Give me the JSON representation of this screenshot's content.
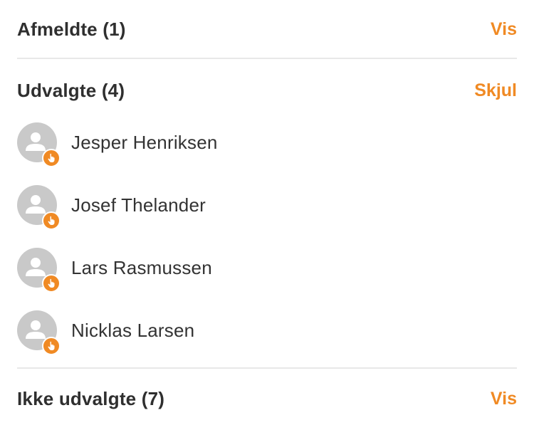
{
  "sections": [
    {
      "title": "Afmeldte (1)",
      "action": "Vis"
    },
    {
      "title": "Udvalgte (4)",
      "action": "Skjul"
    },
    {
      "title": "Ikke udvalgte (7)",
      "action": "Vis"
    }
  ],
  "selected_people": [
    {
      "name": "Jesper Henriksen",
      "avatar_icon": "user-placeholder-icon",
      "badge_icon": "hand-pointer-icon"
    },
    {
      "name": "Josef Thelander",
      "avatar_icon": "user-placeholder-icon",
      "badge_icon": "hand-pointer-icon"
    },
    {
      "name": "Lars Rasmussen",
      "avatar_icon": "user-placeholder-icon",
      "badge_icon": "hand-pointer-icon"
    },
    {
      "name": "Nicklas Larsen",
      "avatar_icon": "user-placeholder-icon",
      "badge_icon": "hand-pointer-icon"
    }
  ],
  "colors": {
    "accent": "#f08a24",
    "text": "#333333",
    "avatar_bg": "#c9c9c9",
    "divider": "#e8e8e8"
  }
}
